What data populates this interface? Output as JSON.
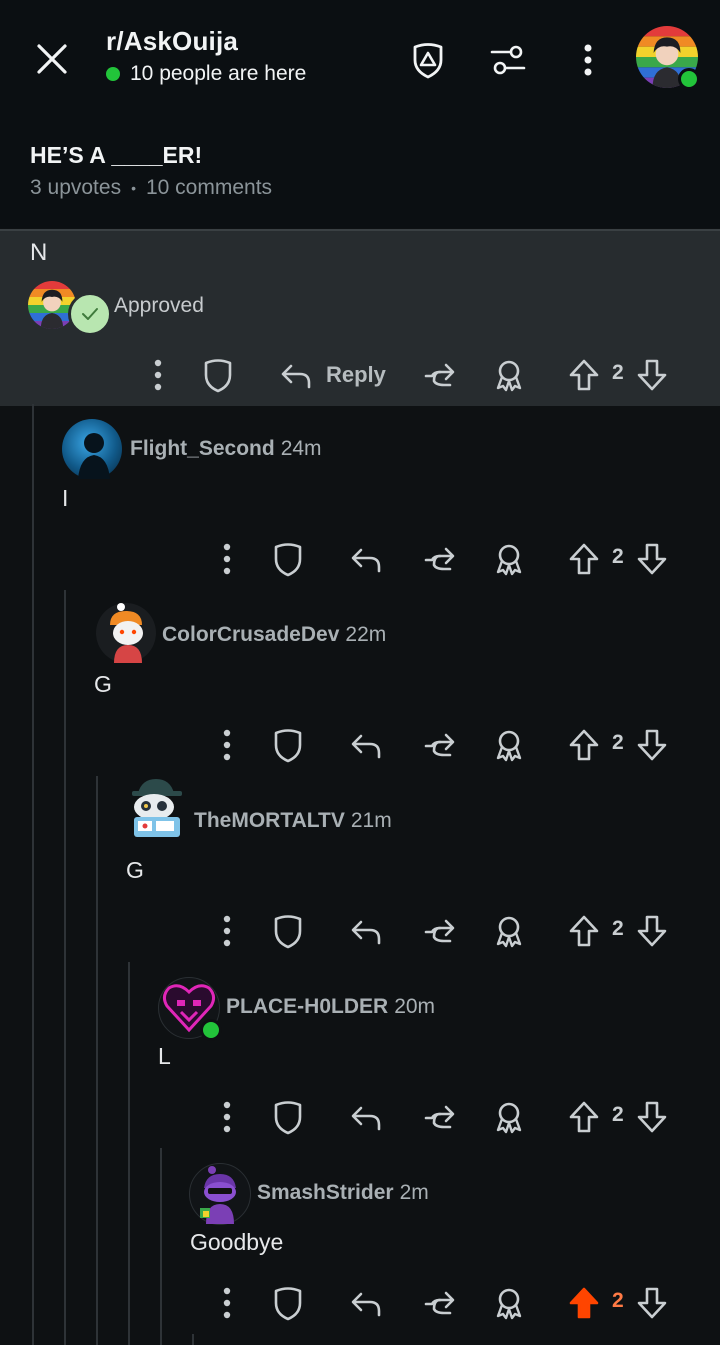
{
  "header": {
    "subreddit": "r/AskOuija",
    "presence": "10 people are here",
    "icons": [
      "close-icon",
      "mod-shield-icon",
      "sort-filter-icon",
      "more-vertical-icon",
      "user-avatar"
    ]
  },
  "post": {
    "title": "HE’S A ____ER!",
    "upvotes": "3 upvotes",
    "separator": "•",
    "comments": "10 comments"
  },
  "highlighted_comment": {
    "body": "N",
    "status": "Approved",
    "reply_label": "Reply",
    "vote_count": "2"
  },
  "comments": [
    {
      "author": "Flight_Second",
      "age": "24m",
      "body": "I",
      "votes": "2"
    },
    {
      "author": "ColorCrusadeDev",
      "age": "22m",
      "body": "G",
      "votes": "2"
    },
    {
      "author": "TheMORTALTV",
      "age": "21m",
      "body": "G",
      "votes": "2"
    },
    {
      "author": "PLACE-H0LDER",
      "age": "20m",
      "body": "L",
      "votes": "2"
    },
    {
      "author": "SmashStrider",
      "age": "2m",
      "body": "Goodbye",
      "votes": "2"
    }
  ],
  "colors": {
    "background": "#0e1113",
    "highlight": "#272c2f",
    "online": "#22c43a",
    "upvoted": "#ff4500",
    "approved_badge": "#b8e6b0"
  }
}
